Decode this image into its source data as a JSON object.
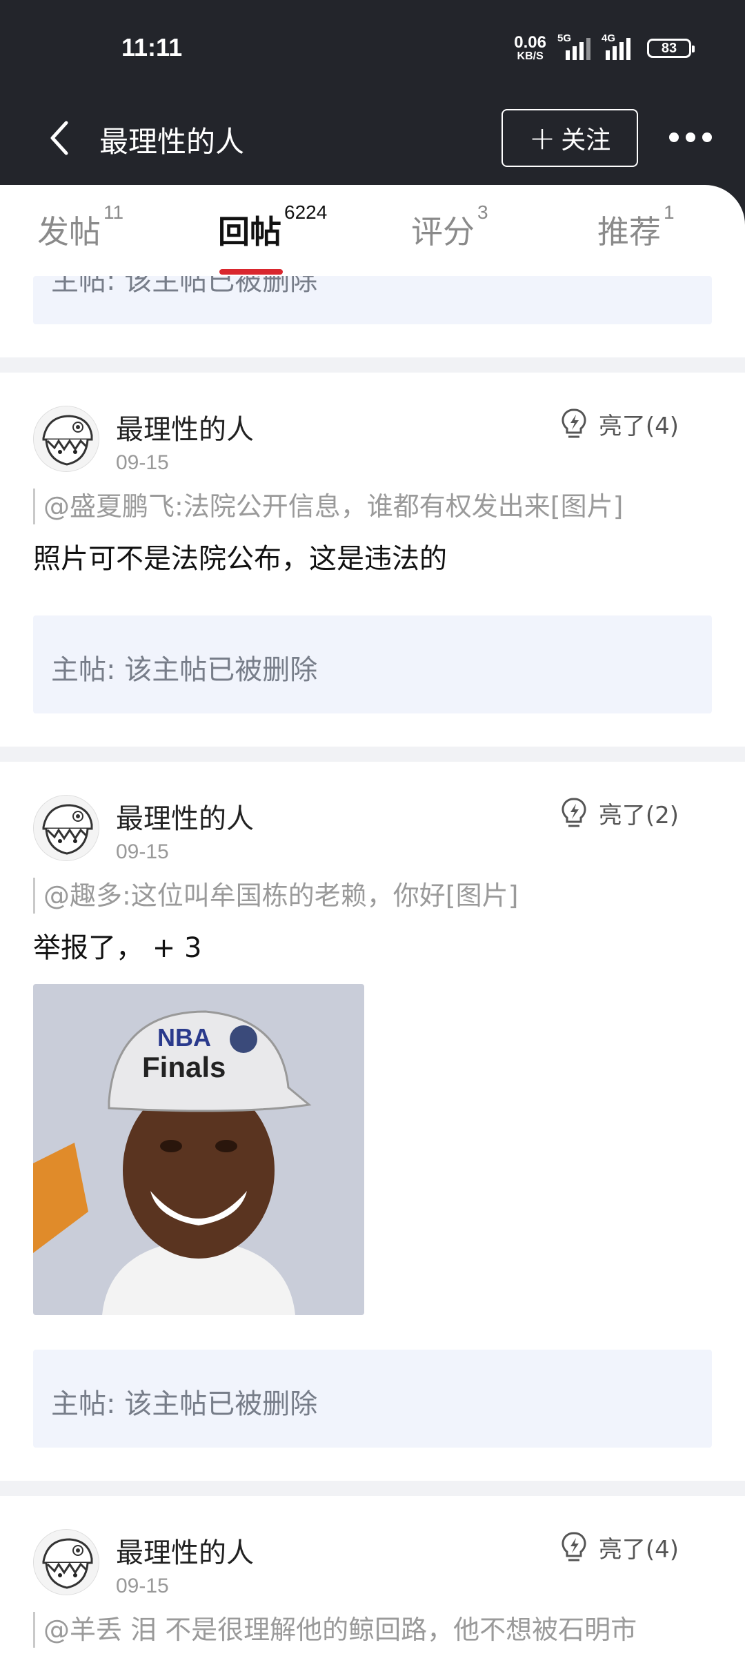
{
  "status_bar": {
    "time": "11:11",
    "net_speed_value": "0.06",
    "net_speed_unit": "KB/S",
    "sig1_label": "5G",
    "sig2_label": "4G",
    "battery": "83"
  },
  "header": {
    "title": "最理性的人",
    "follow_label": "关注",
    "follow_plus": "+"
  },
  "tabs": [
    {
      "label": "发帖",
      "count": "11"
    },
    {
      "label": "回帖",
      "count": "6224"
    },
    {
      "label": "评分",
      "count": "3"
    },
    {
      "label": "推荐",
      "count": "1"
    }
  ],
  "partial_top_quote": "主帖: 该主帖已被删除",
  "posts": [
    {
      "author": "最理性的人",
      "date": "09-15",
      "light_label": "亮了(4)",
      "reference": "@盛夏鹏飞:法院公开信息，谁都有权发出来[图片]",
      "body": "照片可不是法院公布，这是违法的",
      "main_post": "主帖: 该主帖已被删除"
    },
    {
      "author": "最理性的人",
      "date": "09-15",
      "light_label": "亮了(2)",
      "reference": "@趣多:这位叫牟国栋的老赖，你好[图片]",
      "body": "举报了， + 3",
      "main_post": "主帖: 该主帖已被删除"
    },
    {
      "author": "最理性的人",
      "date": "09-15",
      "light_label": "亮了(4)",
      "reference": "@羊丢 泪 不是很理解他的鲸回路，他不想被石明市"
    }
  ],
  "image_badge": {
    "line1": "NBA",
    "line2": "Finals"
  },
  "colors": {
    "header_bg": "#23252b",
    "tab_active_underline": "#d9272e",
    "quote_bg": "#f1f4fc",
    "separator": "#f1f2f5"
  },
  "icons": [
    "back-arrow-icon",
    "more-icon",
    "lightning-bulb-icon"
  ]
}
